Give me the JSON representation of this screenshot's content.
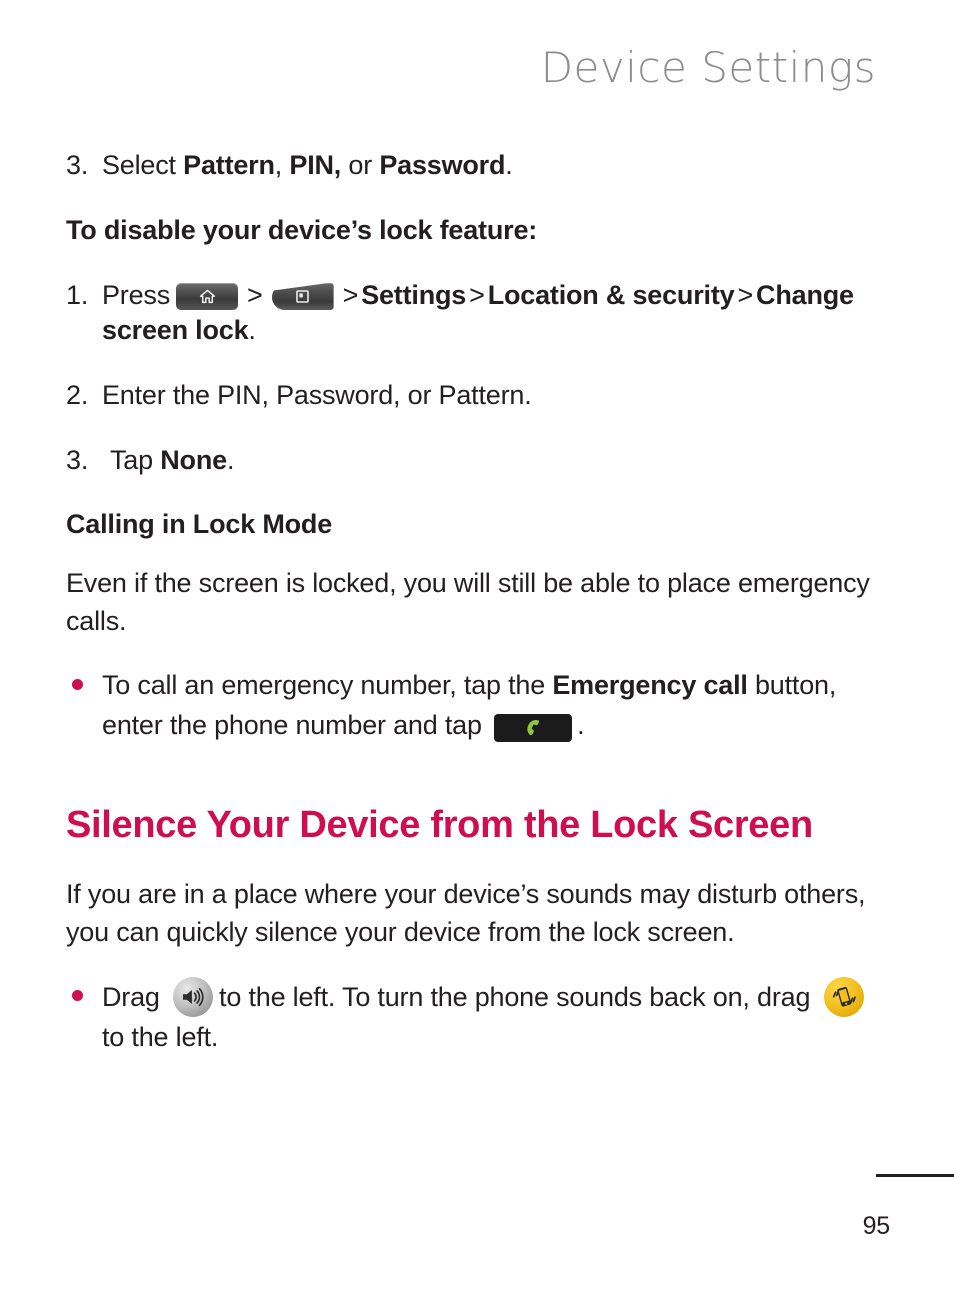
{
  "header": {
    "running_title": "Device Settings",
    "color": "#8c8c8c"
  },
  "colors": {
    "accent": "#ce0e4e",
    "body_text": "#231f20",
    "key_dark": "#3b3b3b",
    "call_button_bg": "#1b1b1b",
    "call_icon_green": "#8dc63f",
    "vibrate_circle": "#f2bf20",
    "speaker_circle": "#bdbdbd"
  },
  "content": {
    "step3_top": {
      "number": "3.",
      "text_pre": "Select ",
      "bold_1": "Pattern",
      "between_1": ", ",
      "bold_2": "PIN,",
      "between_2": " or ",
      "bold_3": "Password",
      "text_post": "."
    },
    "disable_lead": "To disable your device’s lock feature:",
    "step1": {
      "number": "1.",
      "text_pre": "Press",
      "home_key_icon": "home-key-icon",
      "menu_key_icon": "menu-key-icon",
      "chevron": ">",
      "bold_settings": "Settings",
      "bold_location": "Location & security",
      "bold_change": "Change screen lock",
      "text_post": "."
    },
    "step2": {
      "number": "2.",
      "text": "Enter the PIN, Password, or Pattern."
    },
    "step3_bottom": {
      "number": "3.",
      "text_pre": "Tap ",
      "bold": "None",
      "text_post": "."
    },
    "calling_subhead": "Calling in Lock Mode",
    "calling_para": "Even if the screen is locked, you will still be able to place emergency calls.",
    "emergency_bullet": {
      "text_pre": "To call an emergency number, tap the ",
      "bold": "Emergency call",
      "text_mid": " button, enter the phone number and tap ",
      "call_button_icon": "phone-handset-icon",
      "text_post": "."
    },
    "silence_heading": "Silence Your Device from the Lock Screen",
    "silence_para": "If you are in a place where your device’s sounds may disturb others, you can quickly silence your device from the lock screen.",
    "silence_bullet": {
      "text_pre": "Drag ",
      "speaker_icon": "speaker-on-icon",
      "text_mid": "to the left. To turn the phone sounds back on, drag ",
      "vibrate_icon": "vibrate-icon",
      "text_post": " to the left."
    }
  },
  "footer": {
    "page_number": "95"
  }
}
